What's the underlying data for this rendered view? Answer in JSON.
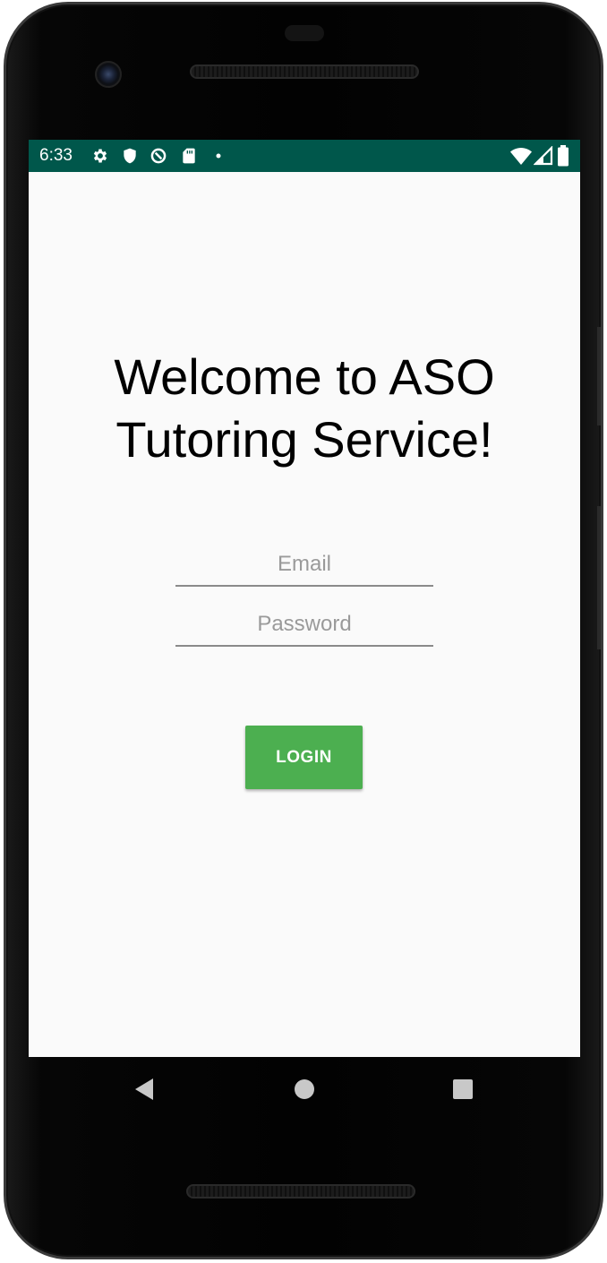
{
  "status_bar": {
    "time": "6:33",
    "icons": [
      "settings-gear-icon",
      "shield-icon",
      "data-saver-icon",
      "sd-card-icon",
      "notification-dot-icon",
      "wifi-icon",
      "cell-signal-icon",
      "battery-icon"
    ],
    "background_color": "#00574b"
  },
  "main": {
    "welcome_line1": "Welcome to ASO",
    "welcome_line2": "Tutoring Service!"
  },
  "form": {
    "email_placeholder": "Email",
    "password_placeholder": "Password",
    "login_label": "LOGIN",
    "login_color": "#4caf50"
  },
  "nav_bar": {
    "buttons": [
      "back-icon",
      "home-icon",
      "recents-icon"
    ]
  }
}
